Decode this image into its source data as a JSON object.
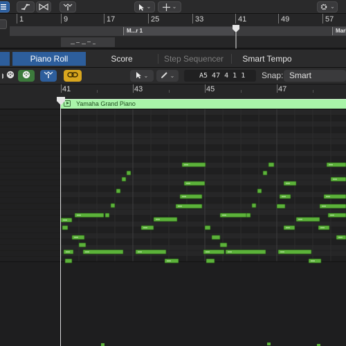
{
  "colors": {
    "accent_blue": "#2d5e9c",
    "note_green": "#5cb23a",
    "note_green_light": "#a9f4a9",
    "toolbar_bg": "#2b2b2c",
    "grid_bg": "#232324"
  },
  "top_toolbar": {
    "icons": [
      "list-icon",
      "automation-curve-icon",
      "bowtie-icon",
      "flex-marquee-icon",
      "pointer-tool-icon",
      "crosshair-tool-icon",
      "gear-icon"
    ]
  },
  "main_ruler": {
    "bars": [
      "1",
      "9",
      "17",
      "25",
      "33",
      "41",
      "49",
      "57"
    ],
    "markers": [
      "M...r 1",
      "Marl"
    ],
    "playhead_bar": "41"
  },
  "tabs": [
    {
      "label": "Piano Roll",
      "active": true
    },
    {
      "label": "Score",
      "active": false
    },
    {
      "label": "Step Sequencer",
      "active": false,
      "dim": true
    },
    {
      "label": "Smart Tempo",
      "active": false
    }
  ],
  "editor_toolbar": {
    "position_note": "A5",
    "position_value": "47 4 1 1",
    "snap_label": "Snap:",
    "snap_value": "Smart"
  },
  "roll_ruler": {
    "bars": [
      "41",
      "43",
      "45",
      "47"
    ]
  },
  "region": {
    "name": "Yamaha Grand Piano"
  }
}
